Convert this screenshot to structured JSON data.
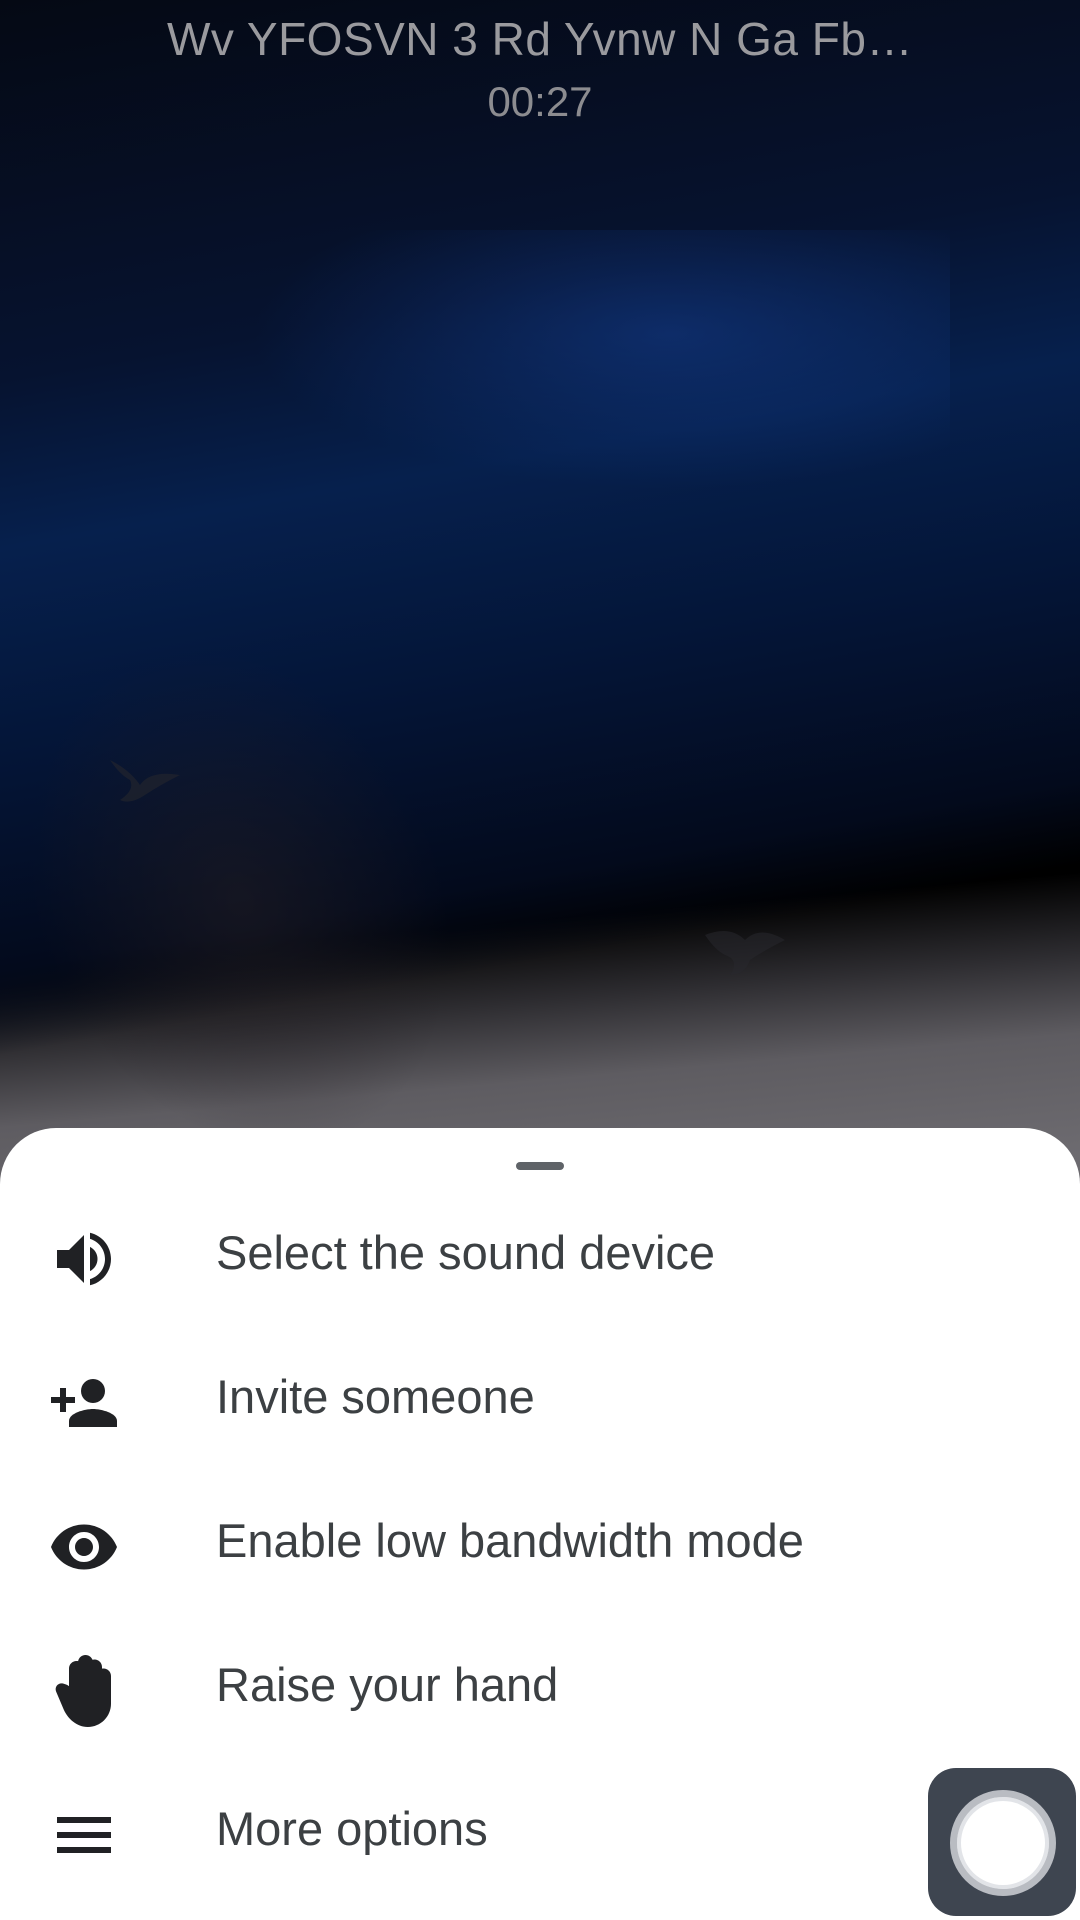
{
  "call": {
    "title": "Wv YFOSVN 3 Rd Yvnw N Ga Fb…",
    "timer": "00:27"
  },
  "sheet": {
    "items": [
      {
        "label": "Select the sound device",
        "icon": "speaker-icon"
      },
      {
        "label": "Invite someone",
        "icon": "add-person-icon"
      },
      {
        "label": "Enable low bandwidth mode",
        "icon": "eye-icon"
      },
      {
        "label": "Raise your hand",
        "icon": "raise-hand-icon"
      },
      {
        "label": "More options",
        "icon": "menu-icon"
      }
    ]
  },
  "colors": {
    "sheet_background": "#ffffff",
    "text": "#3c4043",
    "icon": "#202124",
    "fab_background": "#3e4550"
  }
}
